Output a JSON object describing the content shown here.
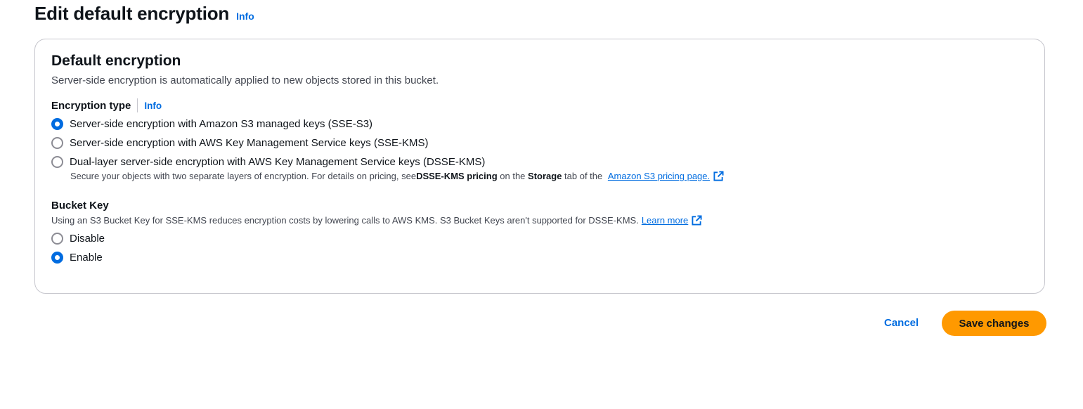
{
  "header": {
    "title": "Edit default encryption",
    "info_label": "Info"
  },
  "default_encryption": {
    "title": "Default encryption",
    "description": "Server-side encryption is automatically applied to new objects stored in this bucket.",
    "encryption_type": {
      "label": "Encryption type",
      "info_label": "Info",
      "selected": "sse-s3",
      "options": [
        {
          "id": "sse-s3",
          "label": "Server-side encryption with Amazon S3 managed keys (SSE-S3)",
          "checked": true
        },
        {
          "id": "sse-kms",
          "label": "Server-side encryption with AWS Key Management Service keys (SSE-KMS)",
          "checked": false
        },
        {
          "id": "dsse-kms",
          "label": "Dual-layer server-side encryption with AWS Key Management Service keys (DSSE-KMS)",
          "checked": false
        }
      ],
      "dsse_description": {
        "part1": "Secure your objects with two separate layers of encryption. For details on pricing, see ",
        "bold1": "DSSE-KMS pricing",
        "part2": " on the ",
        "bold2": "Storage",
        "part3": " tab of the ",
        "link": "Amazon S3 pricing page."
      }
    },
    "bucket_key": {
      "label": "Bucket Key",
      "description": "Using an S3 Bucket Key for SSE-KMS reduces encryption costs by lowering calls to AWS KMS. S3 Bucket Keys aren't supported for DSSE-KMS.",
      "learn_more": "Learn more",
      "selected": "enable",
      "options": [
        {
          "id": "disable",
          "label": "Disable",
          "checked": false
        },
        {
          "id": "enable",
          "label": "Enable",
          "checked": true
        }
      ]
    }
  },
  "actions": {
    "cancel_label": "Cancel",
    "save_label": "Save changes"
  },
  "colors": {
    "link": "#006ce0",
    "primary_button": "#ff9900",
    "radio_checked": "#006ce0"
  }
}
